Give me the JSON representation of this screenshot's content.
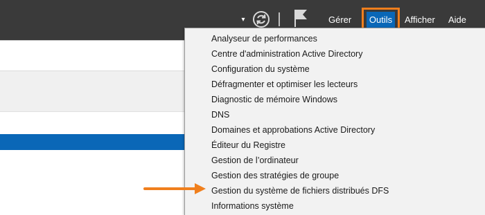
{
  "header": {
    "dropdown_glyph": "▾",
    "menus": {
      "gerer": "Gérer",
      "outils": "Outils",
      "afficher": "Afficher",
      "aide": "Aide"
    },
    "icons": {
      "refresh": "refresh-icon",
      "flag": "notification-flag-icon",
      "dropdown": "chevron-down-icon"
    }
  },
  "tools_menu": {
    "items": [
      "Analyseur de performances",
      "Centre d'administration Active Directory",
      "Configuration du système",
      "Défragmenter et optimiser les lecteurs",
      "Diagnostic de mémoire Windows",
      "DNS",
      "Domaines et approbations Active Directory",
      "Éditeur du Registre",
      "Gestion de l’ordinateur",
      "Gestion des stratégies de groupe",
      "Gestion du système de fichiers distribués DFS",
      "Informations système"
    ]
  },
  "colors": {
    "header_bg": "#3a3a3a",
    "accent_blue": "#0a67b7",
    "highlight_orange": "#f07f1d",
    "menu_bg": "#f2f2f2"
  }
}
